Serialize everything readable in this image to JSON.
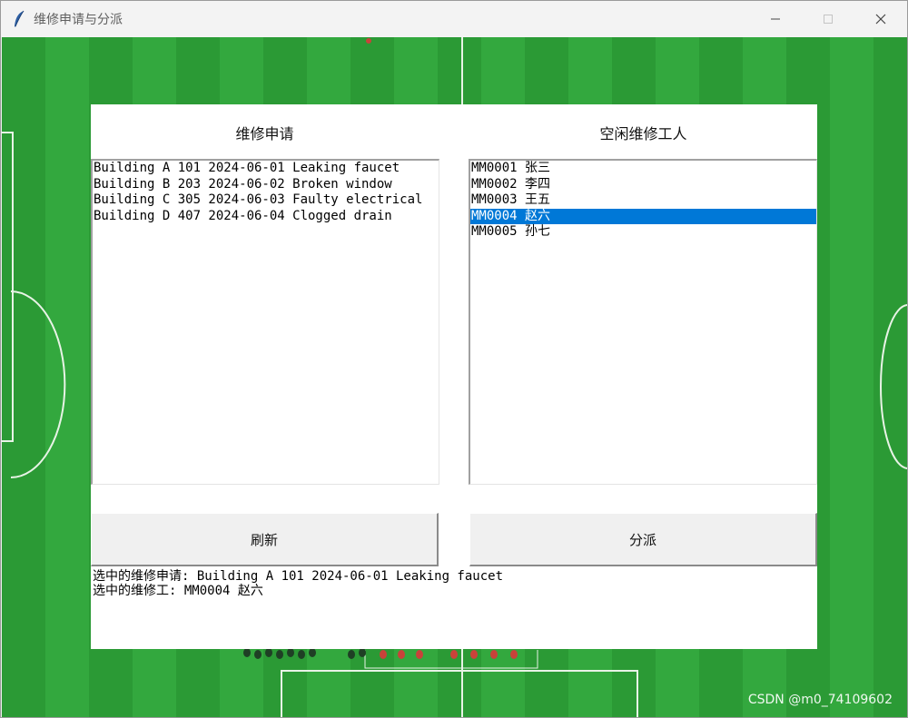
{
  "window": {
    "title": "维修申请与分派",
    "controls": [
      "minimize",
      "maximize",
      "close"
    ]
  },
  "requests_panel": {
    "title": "维修申请",
    "items": [
      "Building A 101 2024-06-01 Leaking faucet",
      "Building B 203 2024-06-02 Broken window",
      "Building C 305 2024-06-03 Faulty electrical",
      "Building D 407 2024-06-04 Clogged drain"
    ]
  },
  "workers_panel": {
    "title": "空闲维修工人",
    "items": [
      "MM0001 张三",
      "MM0002 李四",
      "MM0003 王五",
      "MM0004 赵六",
      "MM0005 孙七"
    ],
    "selected_index": 3
  },
  "buttons": {
    "refresh": "刷新",
    "assign": "分派"
  },
  "status": {
    "selected_request": "选中的维修申请: Building A 101 2024-06-01 Leaking faucet",
    "selected_worker": "选中的维修工: MM0004 赵六"
  },
  "watermark": "CSDN @m0_74109602",
  "colors": {
    "selection": "#0078d7",
    "field_green": "#2b9a35"
  }
}
